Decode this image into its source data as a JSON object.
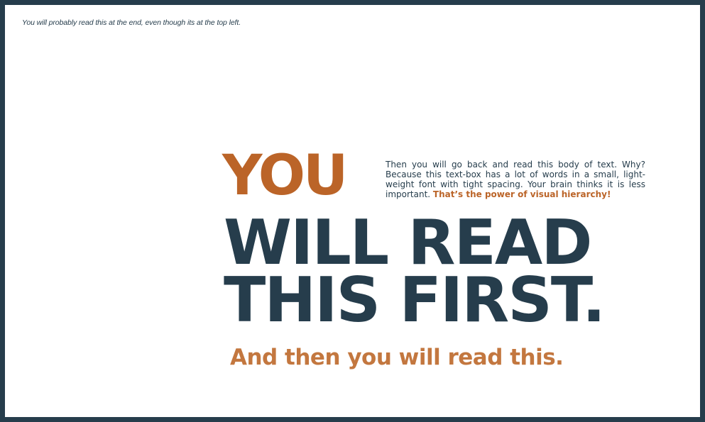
{
  "top_note": "You will probably read this at the end, even though its at the top left.",
  "headline": {
    "you": "YOU",
    "line1": "WILL READ",
    "line2": "THIS FIRST."
  },
  "body_text": {
    "main": "Then you will go back and read this body of text. Why? Because this text-box has a lot of words in a small, light-weight font with tight spacing. Your brain thinks it is less important. ",
    "highlight": "That’s the power of visual hierarchy!"
  },
  "subline": "And then you will read this.",
  "colors": {
    "frame": "#263d4c",
    "navy": "#263d4c",
    "orange": "#bb6428",
    "orange_light": "#c3773f",
    "background": "#ffffff"
  }
}
